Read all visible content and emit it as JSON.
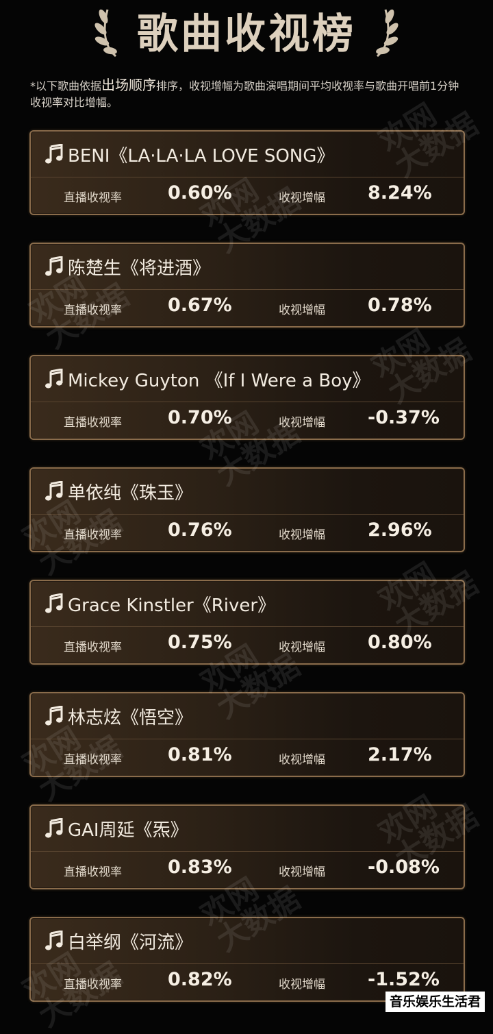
{
  "header": {
    "title": "歌曲收视榜"
  },
  "note": {
    "part1": "*以下歌曲依据",
    "emphasis": "出场顺序",
    "part2": "排序，收视增幅为歌曲演唱期间平均收视率与歌曲开唱前1分钟收视率对比增幅。"
  },
  "labels": {
    "live_rating": "直播收视率",
    "rating_increase": "收视增幅"
  },
  "songs": [
    {
      "title": "BENI《LA·LA·LA LOVE SONG》",
      "live_rating": "0.60%",
      "increase": "8.24%"
    },
    {
      "title": "陈楚生《将进酒》",
      "live_rating": "0.67%",
      "increase": "0.78%"
    },
    {
      "title": "Mickey Guyton 《If I Were a Boy》",
      "live_rating": "0.70%",
      "increase": "-0.37%"
    },
    {
      "title": "单依纯《珠玉》",
      "live_rating": "0.76%",
      "increase": "2.96%"
    },
    {
      "title": "Grace Kinstler《River》",
      "live_rating": "0.75%",
      "increase": "0.80%"
    },
    {
      "title": "林志炫《悟空》",
      "live_rating": "0.81%",
      "increase": "2.17%"
    },
    {
      "title": "GAI周延《炁》",
      "live_rating": "0.83%",
      "increase": "-0.08%"
    },
    {
      "title": "白举纲《河流》",
      "live_rating": "0.82%",
      "increase": "-1.52%"
    }
  ],
  "watermark": {
    "text": "欢网\n大数据"
  },
  "footer": {
    "tag": "音乐娱乐生活君"
  },
  "colors": {
    "accent": "#8a6c4b",
    "card_bg": "#2c2116",
    "background": "#050505"
  },
  "icons": {
    "song": "music-note-icon",
    "decor": "laurel-icon"
  }
}
